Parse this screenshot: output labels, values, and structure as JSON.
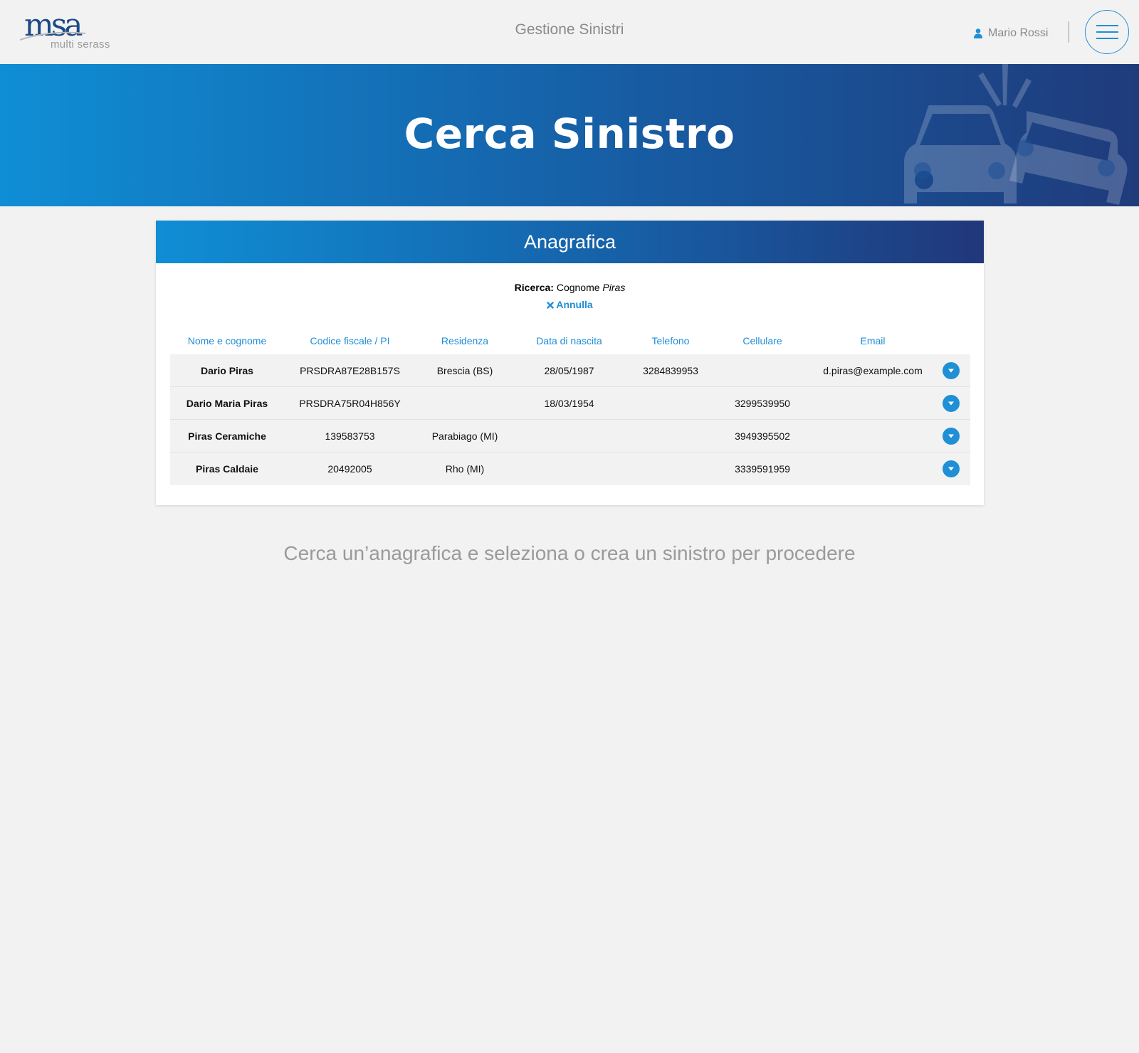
{
  "header": {
    "logo_mark": "msa",
    "logo_sub": "multi serass",
    "app_title": "Gestione Sinistri",
    "user_name": "Mario Rossi",
    "user_icon": "user-icon",
    "menu_icon": "hamburger-icon"
  },
  "hero": {
    "title": "Cerca Sinistro",
    "art": "car-crash-illustration"
  },
  "card": {
    "title": "Anagrafica",
    "search_label": "Ricerca:",
    "search_field": "Cognome",
    "search_value": "Piras",
    "cancel_label": "Annulla",
    "columns": [
      "Nome e cognome",
      "Codice fiscale / PI",
      "Residenza",
      "Data di nascita",
      "Telefono",
      "Cellulare",
      "Email"
    ],
    "rows": [
      [
        "Dario Piras",
        "PRSDRA87E28B157S",
        "Brescia (BS)",
        "28/05/1987",
        "3284839953",
        "",
        "d.piras@example.com"
      ],
      [
        "Dario Maria Piras",
        "PRSDRA75R04H856Y",
        "",
        "18/03/1954",
        "",
        "3299539950",
        ""
      ],
      [
        "Piras Ceramiche",
        "139583753",
        "Parabiago (MI)",
        "",
        "",
        "3949395502",
        ""
      ],
      [
        "Piras Caldaie",
        "20492005",
        "Rho (MI)",
        "",
        "",
        "3339591959",
        ""
      ]
    ]
  },
  "hint": "Cerca un’anagrafica e seleziona o crea un sinistro per procedere",
  "colors": {
    "accent": "#1f8fd6",
    "brand_dark": "#1f3b7b",
    "background": "#f2f2f2"
  }
}
